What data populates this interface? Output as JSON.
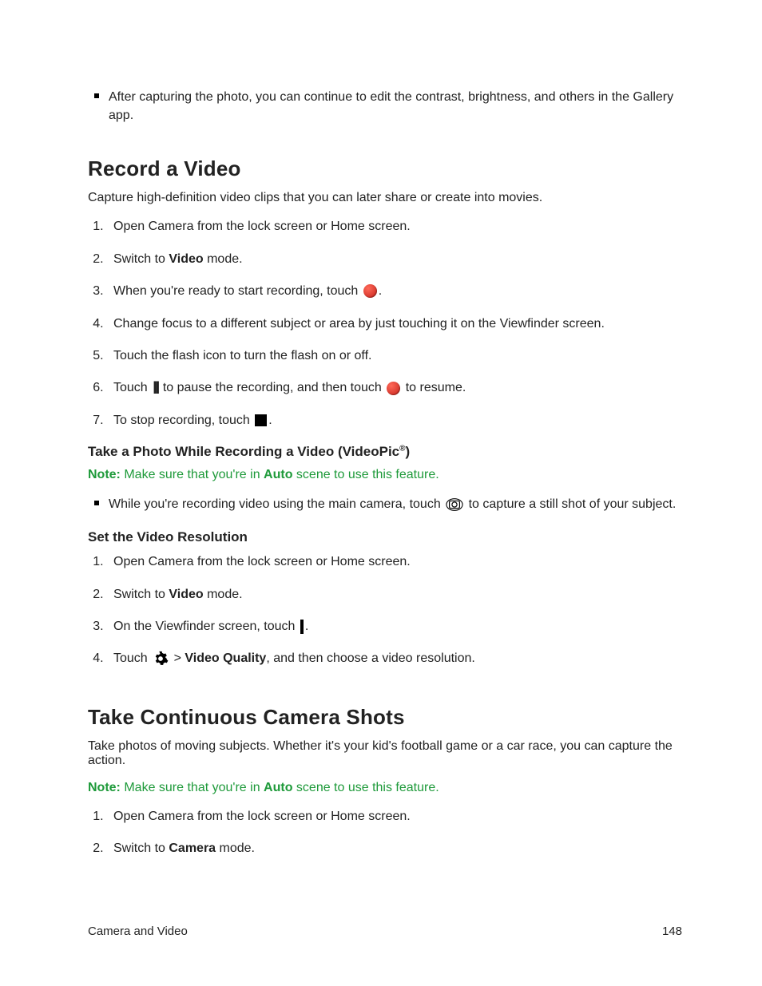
{
  "intro_bullet": "After capturing the photo, you can continue to edit the contrast, brightness, and others in the Gallery app.",
  "section1": {
    "title": "Record a Video",
    "lead": "Capture high-definition video clips that you can later share or create into movies.",
    "steps": {
      "s1": "Open Camera from the lock screen or Home screen.",
      "s2a": "Switch to ",
      "s2b": "Video",
      "s2c": " mode.",
      "s3a": "When you're ready to start recording, touch ",
      "s3b": ".",
      "s4": "Change focus to a different subject or area by just touching it on the Viewfinder screen.",
      "s5": "Touch the flash icon to turn the flash on or off.",
      "s6a": "Touch ",
      "s6b": " to pause the recording, and then touch ",
      "s6c": " to resume.",
      "s7a": "To stop recording, touch ",
      "s7b": "."
    },
    "sub1": {
      "title_a": "Take a Photo While Recording a Video (VideoPic",
      "title_sup": "®",
      "title_b": ")",
      "note_label": "Note:",
      "note_a": " Make sure that you're in ",
      "note_bold": "Auto",
      "note_b": " scene to use this feature.",
      "bullet_a": "While you're recording video using the main camera, touch ",
      "bullet_b": " to capture a still shot of your subject."
    },
    "sub2": {
      "title": "Set the Video Resolution",
      "s1": "Open Camera from the lock screen or Home screen.",
      "s2a": "Switch to ",
      "s2b": "Video",
      "s2c": " mode.",
      "s3a": "On the Viewfinder screen, touch ",
      "s3b": ".",
      "s4a": "Touch ",
      "s4b": " > ",
      "s4c": "Video Quality",
      "s4d": ", and then choose a video resolution."
    }
  },
  "section2": {
    "title": "Take Continuous Camera Shots",
    "lead": "Take photos of moving subjects. Whether it's your kid's football game or a car race, you can capture the action.",
    "note_label": "Note:",
    "note_a": " Make sure that you're in ",
    "note_bold": "Auto",
    "note_b": " scene to use this feature.",
    "s1": "Open Camera from the lock screen or Home screen.",
    "s2a": "Switch to ",
    "s2b": "Camera",
    "s2c": " mode."
  },
  "footer": {
    "left": "Camera and Video",
    "right": "148"
  }
}
